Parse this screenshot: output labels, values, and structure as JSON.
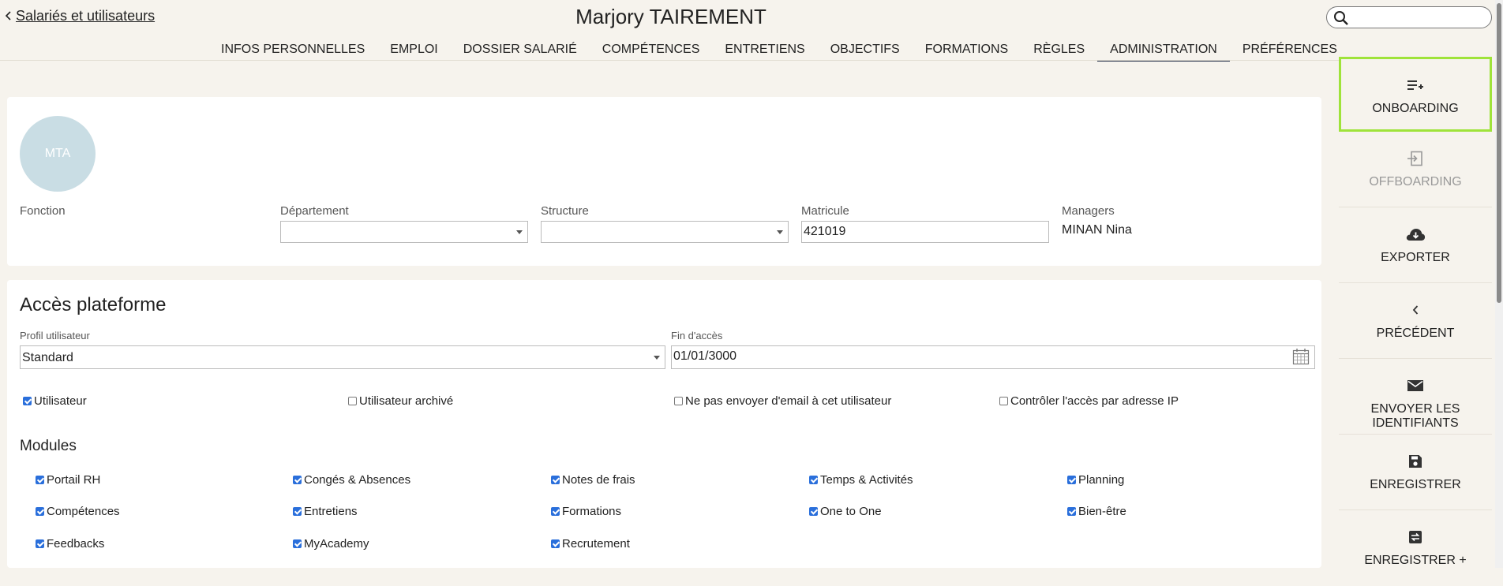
{
  "header": {
    "back_label": "Salariés et utilisateurs",
    "title": "Marjory TAIREMENT",
    "search_placeholder": ""
  },
  "tabs": [
    {
      "label": "INFOS PERSONNELLES"
    },
    {
      "label": "EMPLOI"
    },
    {
      "label": "DOSSIER SALARIÉ"
    },
    {
      "label": "COMPÉTENCES"
    },
    {
      "label": "ENTRETIENS"
    },
    {
      "label": "OBJECTIFS"
    },
    {
      "label": "FORMATIONS"
    },
    {
      "label": "RÈGLES"
    },
    {
      "label": "ADMINISTRATION",
      "active": true
    },
    {
      "label": "PRÉFÉRENCES"
    }
  ],
  "profile": {
    "avatar_initials": "MTA",
    "fonction_label": "Fonction",
    "departement_label": "Département",
    "departement_value": "",
    "structure_label": "Structure",
    "structure_value": "",
    "matricule_label": "Matricule",
    "matricule_value": "421019",
    "managers_label": "Managers",
    "managers_value": "MINAN Nina"
  },
  "access": {
    "title": "Accès plateforme",
    "profil_label": "Profil utilisateur",
    "profil_value": "Standard",
    "fin_label": "Fin d'accès",
    "fin_value": "01/01/3000",
    "options": [
      {
        "label": "Utilisateur",
        "checked": true
      },
      {
        "label": "Utilisateur archivé",
        "checked": false
      },
      {
        "label": "Ne pas envoyer d'email à cet utilisateur",
        "checked": false
      },
      {
        "label": "Contrôler l'accès par adresse IP",
        "checked": false
      }
    ]
  },
  "modules": {
    "title": "Modules",
    "items": [
      {
        "label": "Portail RH",
        "checked": true
      },
      {
        "label": "Congés & Absences",
        "checked": true
      },
      {
        "label": "Notes de frais",
        "checked": true
      },
      {
        "label": "Temps & Activités",
        "checked": true
      },
      {
        "label": "Planning",
        "checked": true
      },
      {
        "label": "Compétences",
        "checked": true
      },
      {
        "label": "Entretiens",
        "checked": true
      },
      {
        "label": "Formations",
        "checked": true
      },
      {
        "label": "One to One",
        "checked": true
      },
      {
        "label": "Bien-être",
        "checked": true
      },
      {
        "label": "Feedbacks",
        "checked": true
      },
      {
        "label": "MyAcademy",
        "checked": true
      },
      {
        "label": "Recrutement",
        "checked": true
      }
    ]
  },
  "actions": [
    {
      "label": "ONBOARDING",
      "icon": "playlist-add-icon",
      "highlight": true
    },
    {
      "label": "OFFBOARDING",
      "icon": "exit-icon",
      "disabled": true
    },
    {
      "label": "EXPORTER",
      "icon": "cloud-download-icon"
    },
    {
      "label": "PRÉCÉDENT",
      "icon": "chevron-left-icon"
    },
    {
      "label": "ENVOYER LES IDENTIFIANTS",
      "icon": "mail-icon"
    },
    {
      "label": "ENREGISTRER",
      "icon": "save-icon"
    },
    {
      "label": "ENREGISTRER +",
      "icon": "save-next-icon"
    }
  ]
}
